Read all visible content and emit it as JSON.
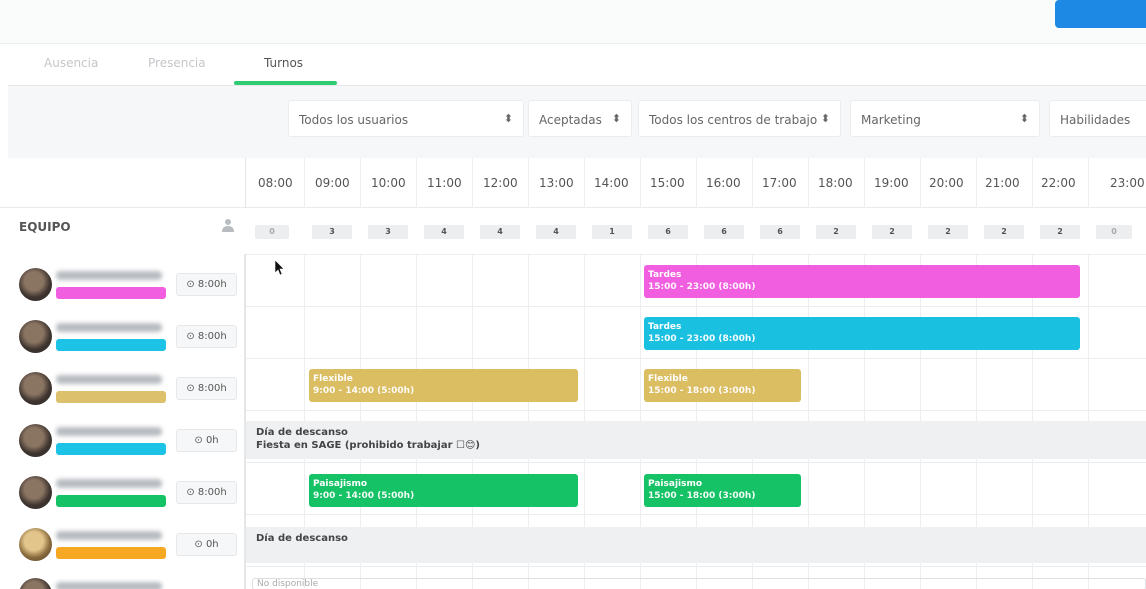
{
  "tabs": [
    {
      "label": "Ausencia",
      "active": false
    },
    {
      "label": "Presencia",
      "active": false
    },
    {
      "label": "Turnos",
      "active": true
    }
  ],
  "filters": {
    "users": "Todos los usuarios",
    "status": "Aceptadas",
    "centers": "Todos los centros de trabajo",
    "department": "Marketing",
    "skills": "Habilidades",
    "sort_glyph": "⬍"
  },
  "hours": [
    "08:00",
    "09:00",
    "10:00",
    "11:00",
    "12:00",
    "13:00",
    "14:00",
    "15:00",
    "16:00",
    "17:00",
    "18:00",
    "19:00",
    "20:00",
    "21:00",
    "22:00",
    "23:00"
  ],
  "team": {
    "label": "EQUIPO",
    "counts": [
      "0",
      "3",
      "3",
      "4",
      "4",
      "4",
      "1",
      "6",
      "6",
      "6",
      "2",
      "2",
      "2",
      "2",
      "2",
      "0"
    ]
  },
  "employees": [
    {
      "hours": "8:00h",
      "tag_color": "#f25ee0"
    },
    {
      "hours": "8:00h",
      "tag_color": "#1cc3e6"
    },
    {
      "hours": "8:00h",
      "tag_color": "#dcc06c"
    },
    {
      "hours": "0h",
      "tag_color": "#1cc3e6"
    },
    {
      "hours": "8:00h",
      "tag_color": "#16c266"
    },
    {
      "hours": "0h",
      "tag_color": "#f7a823"
    }
  ],
  "clock_glyph": "⊙",
  "shifts": {
    "tardes_1": {
      "title": "Tardes",
      "time": "15:00 - 23:00 (8:00h)",
      "color": "#f25ee0"
    },
    "tardes_2": {
      "title": "Tardes",
      "time": "15:00 - 23:00 (8:00h)",
      "color": "#19c0e0"
    },
    "flexible_1": {
      "title": "Flexible",
      "time": "9:00 - 14:00 (5:00h)",
      "color": "#dbbd62"
    },
    "flexible_2": {
      "title": "Flexible",
      "time": "15:00 - 18:00 (3:00h)",
      "color": "#dbbd62"
    },
    "paisajismo_1": {
      "title": "Paisajismo",
      "time": "9:00 - 14:00 (5:00h)",
      "color": "#16c266"
    },
    "paisajismo_2": {
      "title": "Paisajismo",
      "time": "15:00 - 18:00 (3:00h)",
      "color": "#16c266"
    }
  },
  "rest_days": {
    "row4_line1": "Día de descanso",
    "row4_line2": "Fiesta en SAGE (prohibido trabajar ☐😊)",
    "row6_line1": "Día de descanso"
  },
  "unavailable": "No disponible"
}
